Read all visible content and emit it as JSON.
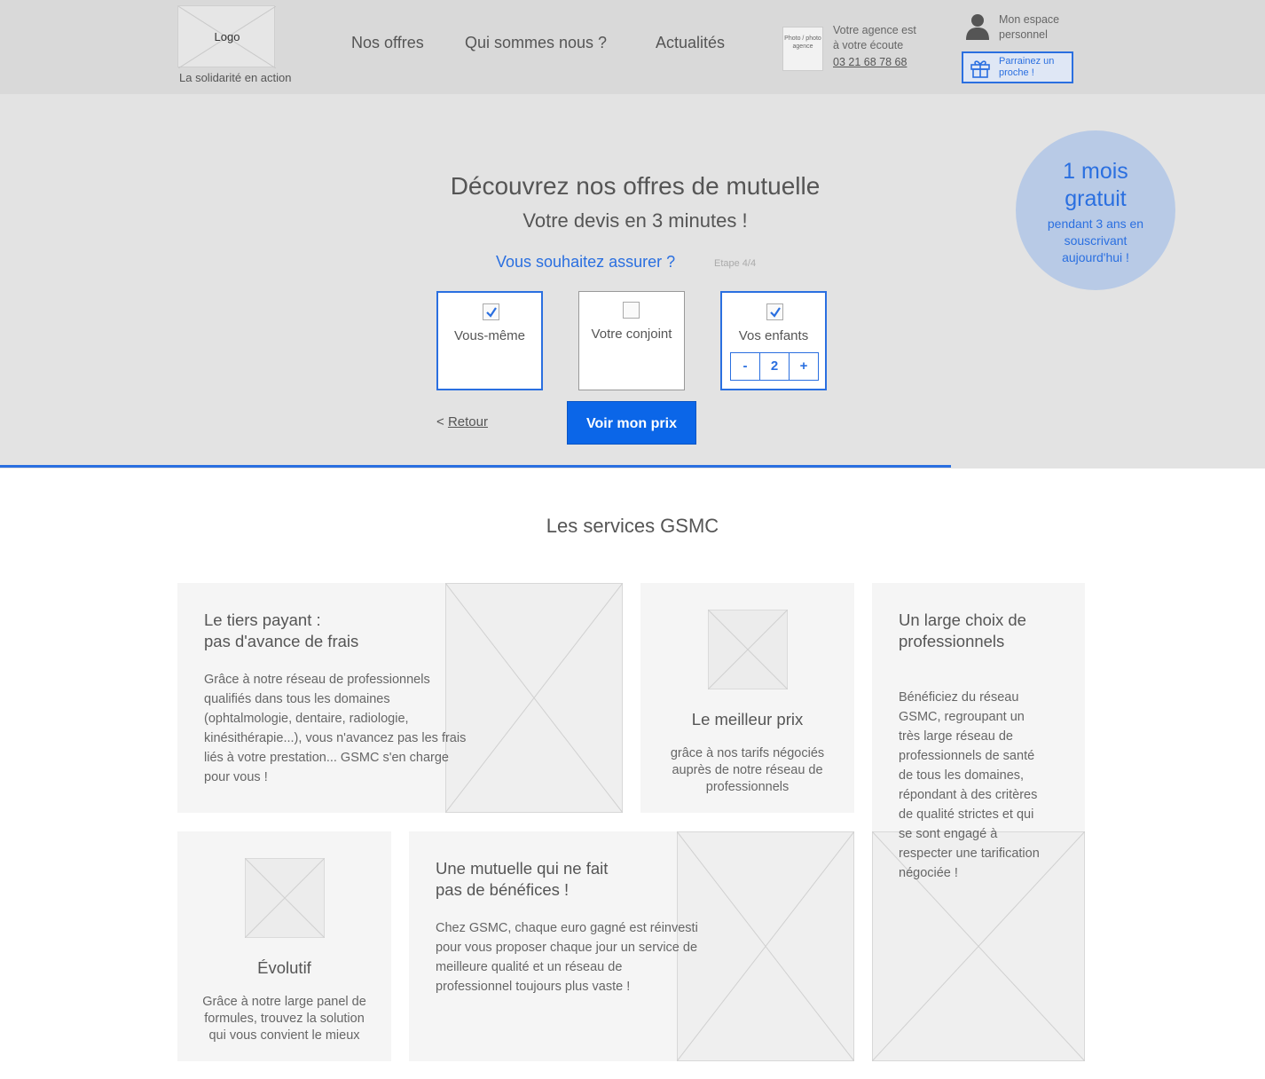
{
  "header": {
    "logo_label": "Logo",
    "tagline": "La solidarité en action",
    "nav": [
      "Nos offres",
      "Qui sommes nous ?",
      "Actualités"
    ],
    "agency_photo_label": "Photo / photo agence",
    "agency_text_line1": "Votre agence est",
    "agency_text_line2": "à votre écoute",
    "agency_phone": "03 21 68 78 68",
    "espace_line1": "Mon espace",
    "espace_line2": "personnel",
    "parrain_label_line1": "Parrainez un",
    "parrain_label_line2": "proche !"
  },
  "hero": {
    "title": "Découvrez nos offres de mutuelle",
    "subtitle": "Votre devis en 3 minutes !",
    "question": "Vous souhaitez assurer ?",
    "step": "Etape 4/4",
    "choices": [
      {
        "label": "Vous-même",
        "checked": true
      },
      {
        "label": "Votre conjoint",
        "checked": false
      },
      {
        "label": "Vos enfants",
        "checked": true
      }
    ],
    "stepper": {
      "minus": "-",
      "value": "2",
      "plus": "+"
    },
    "back_prefix": "< ",
    "back_label": "Retour",
    "cta_label": "Voir mon prix",
    "promo_big_line1": "1 mois",
    "promo_big_line2": "gratuit",
    "promo_small": "pendant 3 ans en souscrivant aujourd'hui !"
  },
  "services": {
    "title": "Les services GSMC",
    "cards": [
      {
        "title_line1": "Le tiers payant :",
        "title_line2": "pas d'avance de frais",
        "text_lines": [
          "Grâce à notre réseau de professionnels",
          "qualifiés dans tous les domaines",
          "(ophtalmologie, dentaire, radiologie,",
          "kinésithérapie...), vous n'avancez pas les frais",
          "liés à votre prestation... GSMC s'en charge",
          "pour vous !"
        ]
      },
      {
        "title": "Le meilleur prix",
        "text_lines": [
          "grâce à nos tarifs négociés",
          "auprès de notre réseau de",
          "professionnels"
        ]
      },
      {
        "title_line1": "Un large choix de",
        "title_line2": "professionnels",
        "text_lines": [
          "Bénéficiez du réseau",
          "GSMC, regroupant un",
          "très large réseau de",
          "professionnels de santé",
          "de tous les domaines,",
          "répondant à des critères",
          "de qualité strictes et qui",
          "se sont engagé à",
          "respecter une tarification",
          "négociée !"
        ]
      },
      {
        "title": "Évolutif",
        "text_lines": [
          "Grâce à notre large panel de",
          "formules, trouvez la solution",
          "qui vous convient le mieux"
        ]
      },
      {
        "title_line1": "Une mutuelle qui ne fait",
        "title_line2": "pas de bénéfices !",
        "text_lines": [
          "Chez GSMC, chaque euro gagné est réinvesti",
          "pour vous proposer chaque jour un service de",
          "meilleure qualité et un réseau de",
          "professionnel toujours plus vaste !"
        ]
      }
    ]
  },
  "colors": {
    "accent": "#2a6fe0",
    "cta": "#0b66e8",
    "header_bg": "#d9d9d9",
    "hero_bg": "#e3e3e3",
    "promo_bg": "#b8cae6"
  }
}
